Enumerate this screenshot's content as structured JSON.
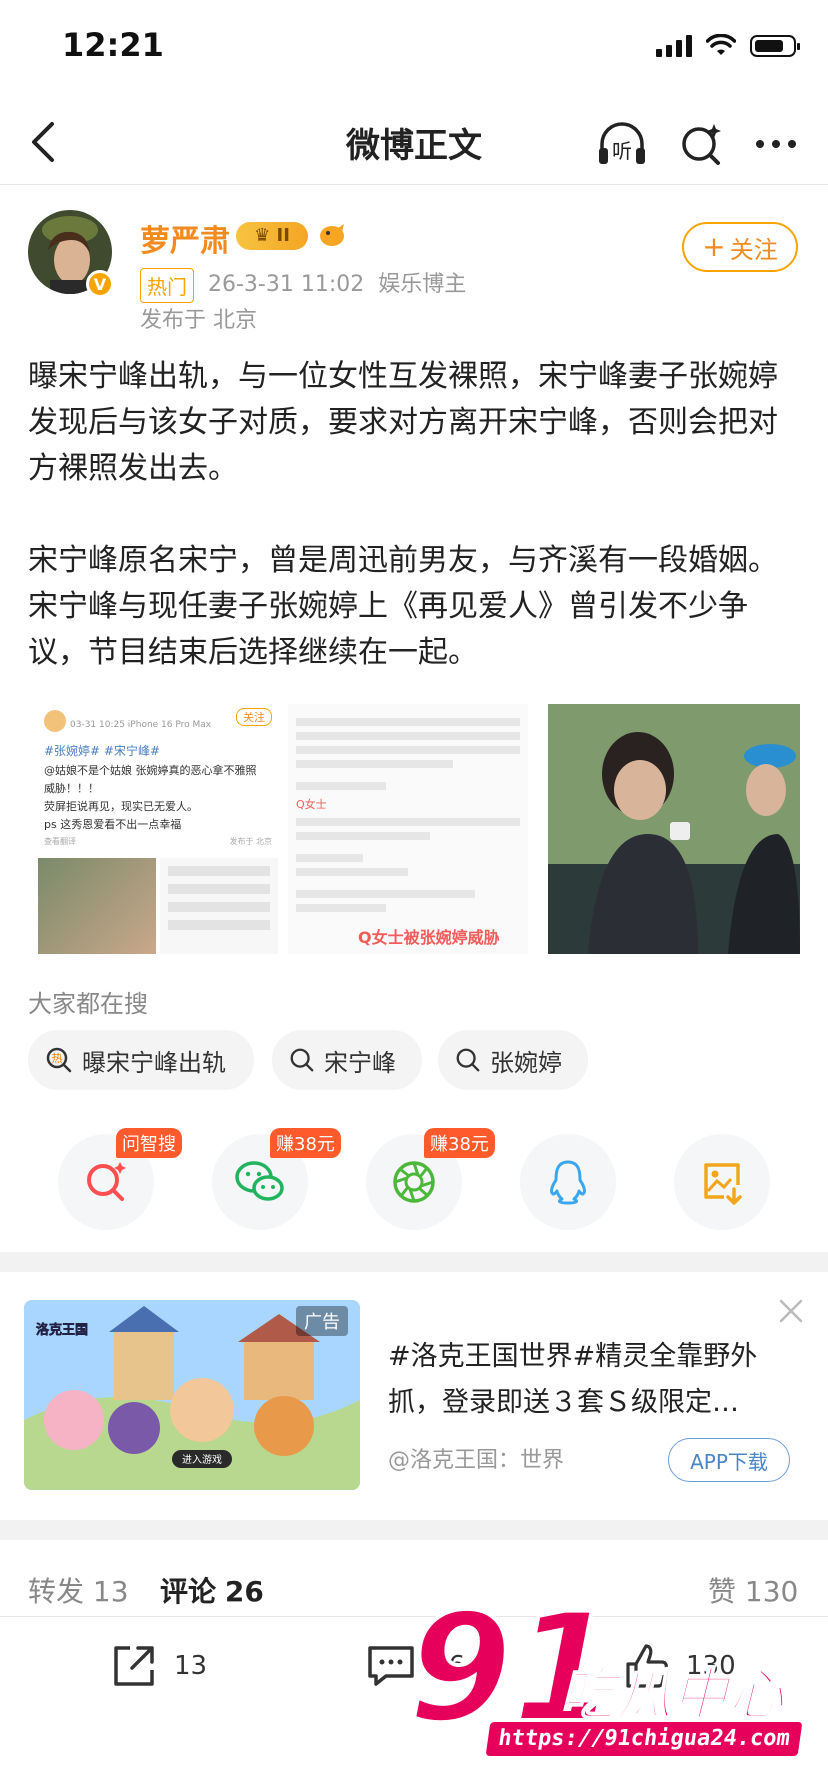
{
  "status_bar": {
    "time": "12:21"
  },
  "nav": {
    "title": "微博正文",
    "listen_label": "听"
  },
  "author": {
    "name": "萝严肃",
    "level_badge": "II",
    "hot_tag": "热门",
    "time": "26-3-31 11:02",
    "category": "娱乐博主",
    "location": "发布于 北京",
    "follow_label": "关注",
    "verified_mark": "V"
  },
  "post": {
    "paragraphs": [
      "曝宋宁峰出轨，与一位女性互发裸照，宋宁峰妻子张婉婷发现后与该女子对质，要求对方离开宋宁峰，否则会把对方裸照发出去。",
      "宋宁峰原名宋宁，曾是周迅前男友，与齐溪有一段婚姻。宋宁峰与现任妻子张婉婷上《再见爱人》曾引发不少争议，节目结束后选择继续在一起。"
    ]
  },
  "images": {
    "img1": {
      "follow": "关注",
      "time": "03-31 10:25  iPhone 16 Pro Max",
      "tags": "#张婉婷# #宋宁峰#",
      "line1": "@姑娘不是个姑娘 张婉婷真的恶心拿不雅照",
      "line2": "威胁！！！",
      "line3": "荧屏拒说再见，现实已无爱人。",
      "line4": "ps 这秀恩爱看不出一点幸福",
      "footer_left": "查看翻译",
      "footer_right": "发布于 北京"
    },
    "img2": {
      "speaker": "Q女士",
      "caption": "Q女士被张婉婷威胁"
    }
  },
  "search": {
    "title": "大家都在搜",
    "hot_glyph": "热",
    "chips": [
      "曝宋宁峰出轨",
      "宋宁峰",
      "张婉婷"
    ]
  },
  "share": {
    "badges": [
      "问智搜",
      "赚38元",
      "赚38元"
    ],
    "colors": {
      "wechat": "#22b35e",
      "moments": "#4cb83a",
      "qq": "#3aa6ee",
      "save": "#f3a51b",
      "ai": "#ff4e50"
    }
  },
  "ad": {
    "label": "广告",
    "text": "#洛克王国世界#精灵全靠野外抓，登录即送３套Ｓ级限定…",
    "source": "@洛克王国：世界",
    "button": "APP下载",
    "game_logo": "洛克王国",
    "enter": "进入游戏"
  },
  "tabs": {
    "repost_label": "转发",
    "repost_count": "13",
    "comment_label": "评论",
    "comment_count": "26",
    "like_label": "赞",
    "like_count": "130"
  },
  "bottom_bar": {
    "repost": "13",
    "comment": "26",
    "like": "130"
  },
  "watermark": {
    "number": "91",
    "title": "吃瓜中心",
    "url": "https://91chigua24.com"
  }
}
